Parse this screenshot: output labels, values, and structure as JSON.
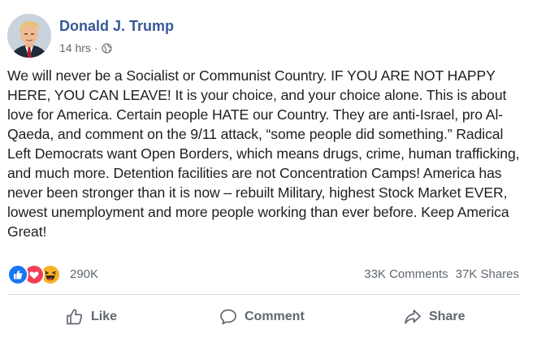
{
  "post": {
    "author": "Donald J. Trump",
    "time": "14 hrs",
    "separator": "·",
    "privacy_icon": "globe-icon",
    "text": "We will never be a Socialist or Communist Country. IF YOU ARE NOT HAPPY HERE, YOU CAN LEAVE! It is your choice, and your choice alone. This is about love for America. Certain people HATE our Country. They are anti-Israel, pro Al-Qaeda, and comment on the 9/11 attack, “some people did something.” Radical Left Democrats want Open Borders, which means drugs, crime, human trafficking, and much more. Detention facilities are not Concentration Camps! America has never been stronger than it is now – rebuilt Military, highest Stock Market EVER, lowest unemployment and more people working than ever before. Keep America Great!"
  },
  "reactions": {
    "icons": [
      "like-reaction-icon",
      "love-reaction-icon",
      "haha-reaction-icon"
    ],
    "count": "290K"
  },
  "engagement": {
    "comments": "33K Comments",
    "shares": "37K Shares"
  },
  "actions": {
    "like_label": "Like",
    "comment_label": "Comment",
    "share_label": "Share"
  },
  "colors": {
    "author_link": "#385898",
    "secondary_text": "#606770",
    "like_blue": "#1877f2",
    "love_red": "#f33e58",
    "haha_yellow": "#f7b125"
  }
}
